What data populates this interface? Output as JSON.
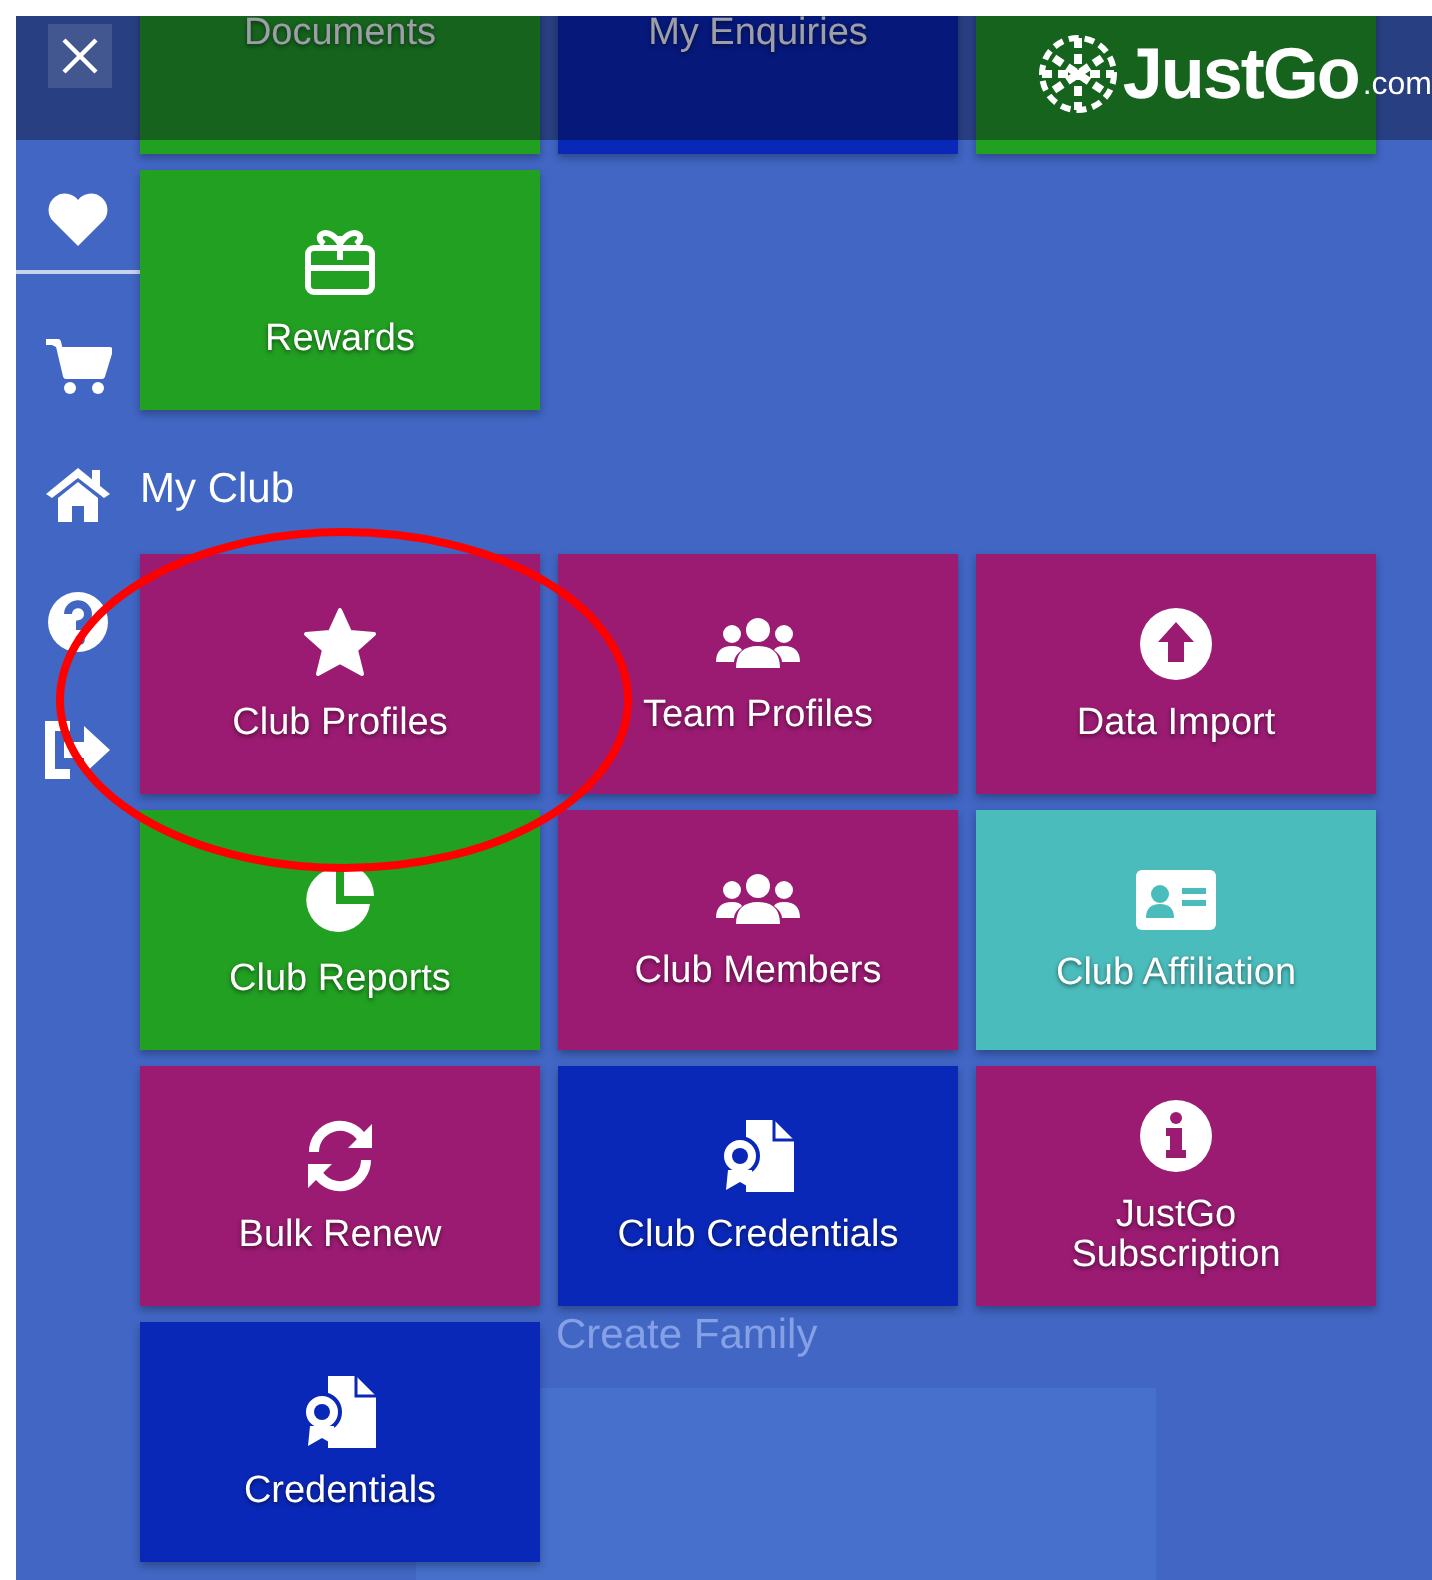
{
  "header": {
    "logo": "JustGo",
    "logo_suffix": ".com"
  },
  "sidebar": {
    "items": [
      {
        "kind": "heart"
      },
      {
        "kind": "cart"
      },
      {
        "kind": "home"
      },
      {
        "kind": "help"
      },
      {
        "kind": "signout"
      }
    ]
  },
  "background": {
    "texts": [
      "Create Family"
    ]
  },
  "sections": [
    {
      "tiles": [
        {
          "label": "Documents",
          "color": "#22a022",
          "kind": "text"
        },
        {
          "label": "My Enquiries",
          "color": "#0a28b8",
          "kind": "text"
        },
        {
          "color": "#22a022",
          "kind": "text"
        },
        {
          "label": "Rewards",
          "color": "#22a022",
          "kind": "gift"
        }
      ]
    },
    {
      "heading": "My Club",
      "tiles": [
        {
          "label": "Club Profiles",
          "color": "#9b1b72",
          "kind": "star"
        },
        {
          "label": "Team Profiles",
          "color": "#9b1b72",
          "kind": "users"
        },
        {
          "label": "Data Import",
          "color": "#9b1b72",
          "kind": "upload"
        },
        {
          "label": "Club Reports",
          "color": "#22a022",
          "kind": "pie"
        },
        {
          "label": "Club Members",
          "color": "#9b1b72",
          "kind": "users"
        },
        {
          "label": "Club Affiliation",
          "color": "#4bbcbc",
          "kind": "idcard"
        },
        {
          "label": "Bulk Renew",
          "color": "#9b1b72",
          "kind": "refresh"
        },
        {
          "label": "Club Credentials",
          "color": "#0a28b8",
          "kind": "certificate"
        },
        {
          "label": "JustGo Subscription",
          "color": "#9b1b72",
          "kind": "info"
        },
        {
          "label": "Credentials",
          "color": "#0a28b8",
          "kind": "certificate"
        }
      ]
    }
  ]
}
